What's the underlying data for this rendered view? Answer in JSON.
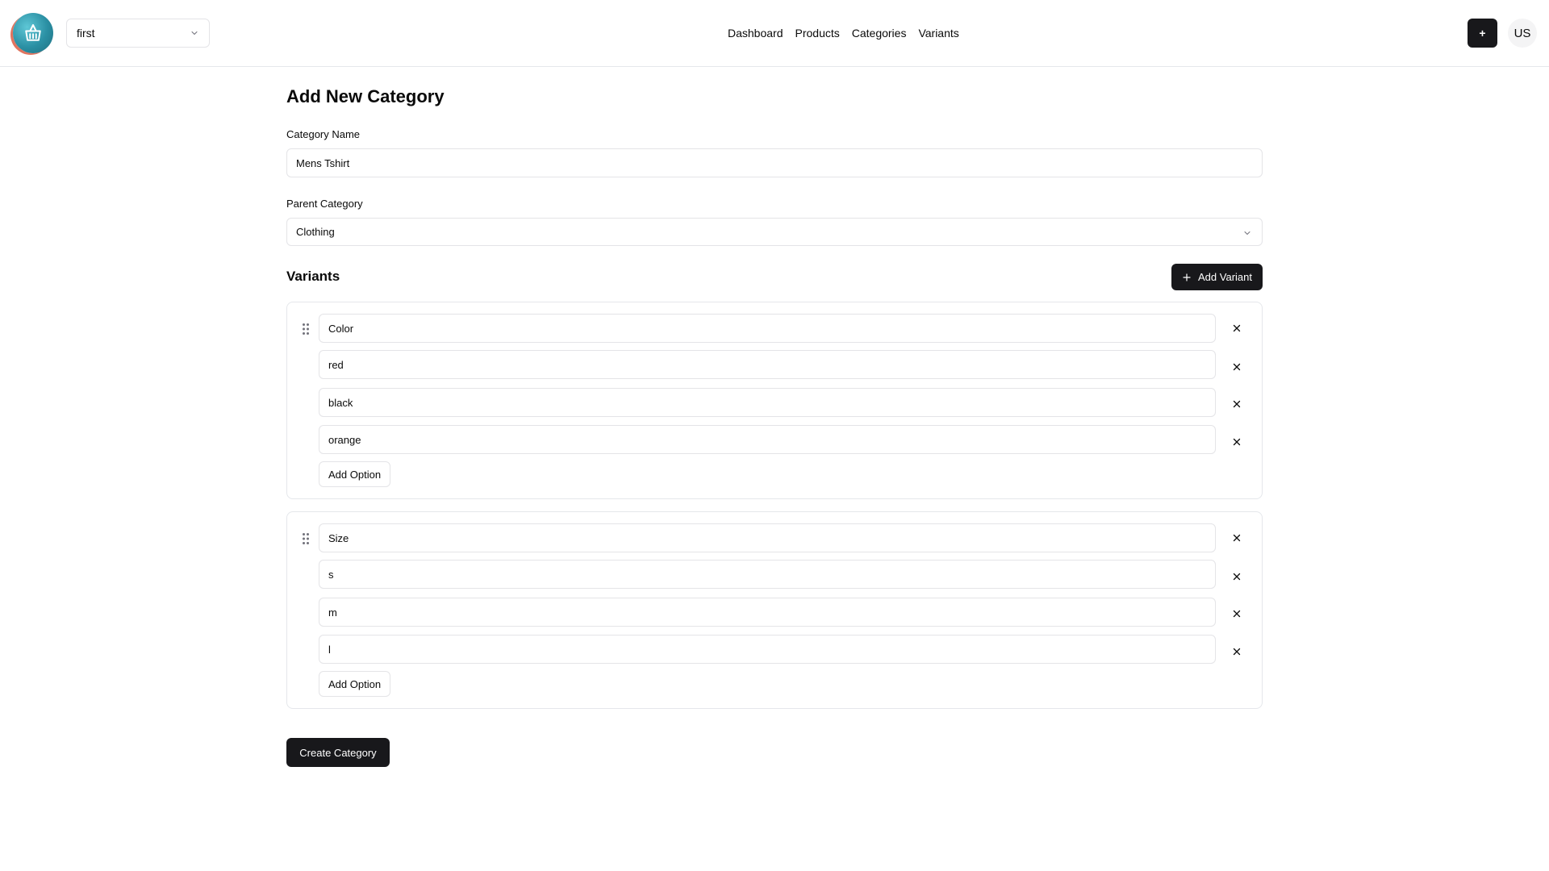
{
  "header": {
    "store_selected": "first",
    "nav": [
      "Dashboard",
      "Products",
      "Categories",
      "Variants"
    ],
    "plus_label": "+",
    "avatar_initials": "US"
  },
  "form": {
    "title": "Add New Category",
    "category_name_label": "Category Name",
    "category_name_value": "Mens Tshirt",
    "parent_category_label": "Parent Category",
    "parent_category_value": "Clothing",
    "variants_title": "Variants",
    "add_variant_label": "Add Variant",
    "variants": [
      {
        "name": "Color",
        "options": [
          "red",
          "black",
          "orange"
        ],
        "add_option_label": "Add Option"
      },
      {
        "name": "Size",
        "options": [
          "s",
          "m",
          "l"
        ],
        "add_option_label": "Add Option"
      }
    ],
    "create_label": "Create Category"
  },
  "icons": {
    "logo": "shopping-basket-icon",
    "chevron": "chevron-down-icon",
    "drag": "grip-vertical-icon",
    "remove": "close-icon",
    "plus": "plus-icon"
  }
}
